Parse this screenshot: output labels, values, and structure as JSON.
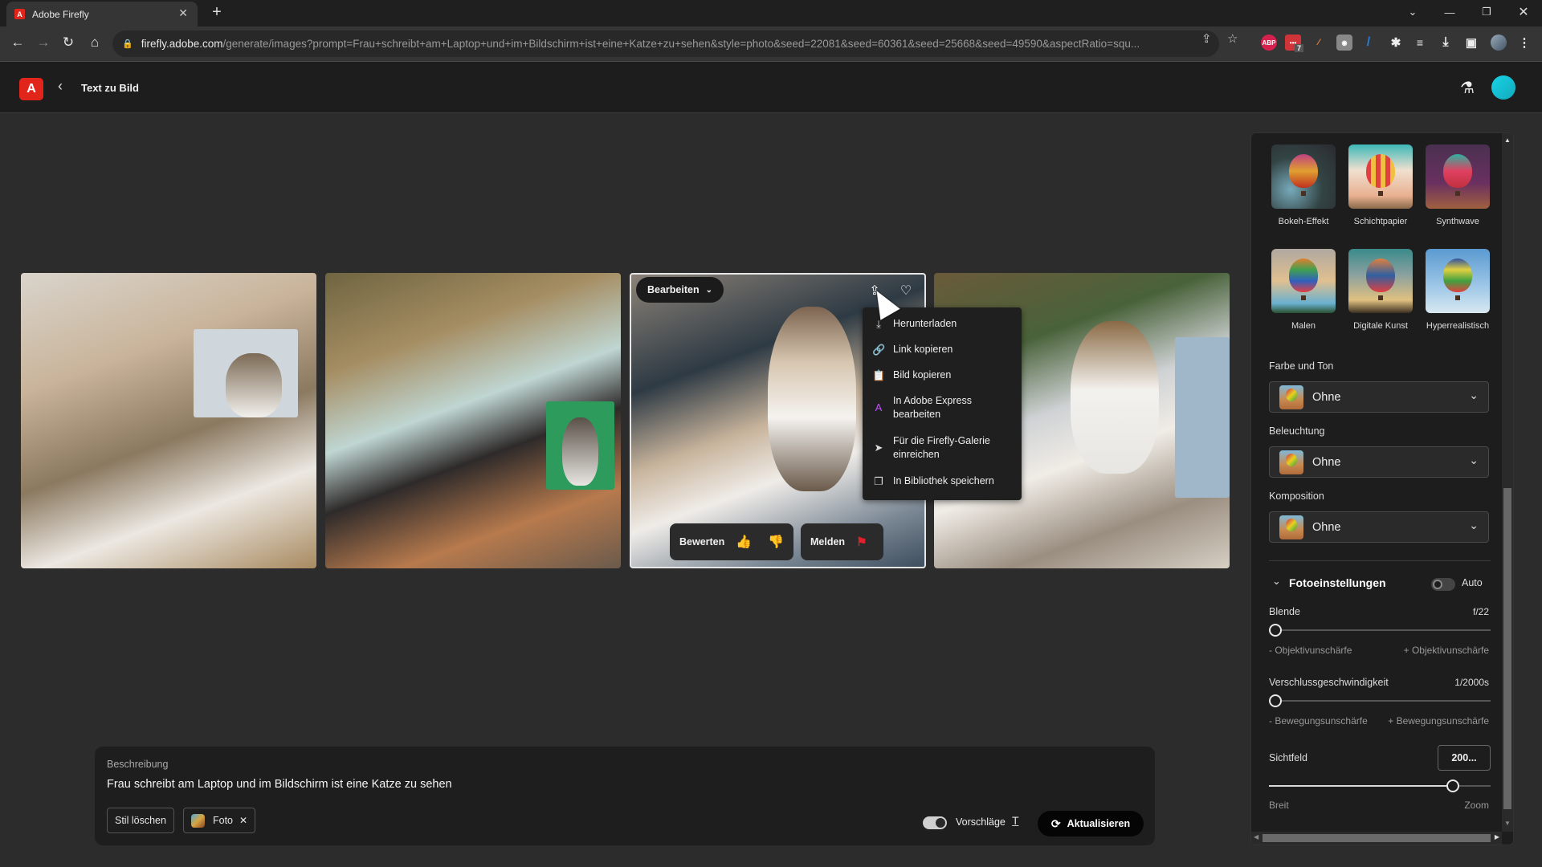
{
  "browser": {
    "tab_title": "Adobe Firefly",
    "tab_favicon": "adobe-firefly-icon",
    "url_host": "firefly.adobe.com",
    "url_path": "/generate/images?prompt=Frau+schreibt+am+Laptop+und+im+Bildschirm+ist+eine+Katze+zu+sehen&style=photo&seed=22081&seed=60361&seed=25668&seed=49590&aspectRatio=squ...",
    "extension_badge": "7",
    "abp_label": "ABP"
  },
  "app": {
    "logo_letter": "A",
    "page_title": "Text zu Bild"
  },
  "image_hover": {
    "edit_label": "Bearbeiten",
    "rate_label": "Bewerten",
    "report_label": "Melden"
  },
  "share_menu": {
    "items": [
      {
        "label": "Herunterladen",
        "icon": "download-icon"
      },
      {
        "label": "Link kopieren",
        "icon": "link-icon"
      },
      {
        "label": "Bild kopieren",
        "icon": "clipboard-icon"
      },
      {
        "label": "In Adobe Express bearbeiten",
        "line1": "In Adobe Express",
        "line2": "bearbeiten",
        "icon": "adobe-express-icon"
      },
      {
        "label": "Für die Firefly-Galerie einreichen",
        "line1": "Für die Firefly-Galerie",
        "line2": "einreichen",
        "icon": "send-icon"
      },
      {
        "label": "In Bibliothek speichern",
        "icon": "library-icon"
      }
    ]
  },
  "prompt": {
    "label": "Beschreibung",
    "text": "Frau schreibt am Laptop und im Bildschirm ist eine Katze zu sehen",
    "clear_style_label": "Stil löschen",
    "style_chip_label": "Foto",
    "suggestions_label": "Vorschläge",
    "suggestions_on": true,
    "refresh_label": "Aktualisieren"
  },
  "panel": {
    "styles": [
      {
        "name": "Bokeh-Effekt"
      },
      {
        "name": "Schichtpapier"
      },
      {
        "name": "Synthwave"
      },
      {
        "name": "Malen"
      },
      {
        "name": "Digitale Kunst"
      },
      {
        "name": "Hyperrealistisch"
      }
    ],
    "color_tone": {
      "label": "Farbe und Ton",
      "value": "Ohne"
    },
    "lighting": {
      "label": "Beleuchtung",
      "value": "Ohne"
    },
    "composition": {
      "label": "Komposition",
      "value": "Ohne"
    },
    "photo_settings": {
      "title": "Fotoeinstellungen",
      "auto_label": "Auto",
      "auto_on": false,
      "aperture": {
        "label": "Blende",
        "value": "f/22",
        "position": 0,
        "min_hint": "- Objektivunschärfe",
        "max_hint": "+ Objektivunschärfe"
      },
      "shutter": {
        "label": "Verschlussgeschwindigkeit",
        "value": "1/2000s",
        "position": 0,
        "min_hint": "- Bewegungsunschärfe",
        "max_hint": "+ Bewegungsunschärfe"
      },
      "fov": {
        "label": "Sichtfeld",
        "value": "200...",
        "position": 0.85,
        "min_hint": "Breit",
        "max_hint": "Zoom"
      }
    }
  }
}
